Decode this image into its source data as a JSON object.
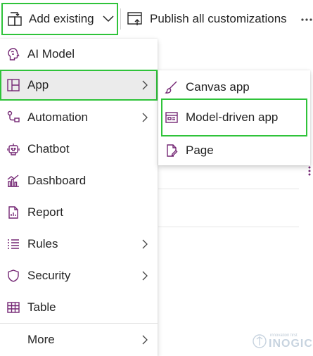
{
  "toolbar": {
    "add_existing_label": "Add existing",
    "publish_label": "Publish all customizations"
  },
  "menu": {
    "items": [
      {
        "label": "AI Model",
        "icon": "ai-model-icon",
        "has_submenu": false
      },
      {
        "label": "App",
        "icon": "app-icon",
        "has_submenu": true
      },
      {
        "label": "Automation",
        "icon": "automation-icon",
        "has_submenu": true
      },
      {
        "label": "Chatbot",
        "icon": "chatbot-icon",
        "has_submenu": false
      },
      {
        "label": "Dashboard",
        "icon": "dashboard-icon",
        "has_submenu": false
      },
      {
        "label": "Report",
        "icon": "report-icon",
        "has_submenu": false
      },
      {
        "label": "Rules",
        "icon": "rules-icon",
        "has_submenu": true
      },
      {
        "label": "Security",
        "icon": "security-icon",
        "has_submenu": true
      },
      {
        "label": "Table",
        "icon": "table-icon",
        "has_submenu": false
      },
      {
        "label": "More",
        "icon": "",
        "has_submenu": true
      }
    ]
  },
  "submenu": {
    "items": [
      {
        "label": "Canvas app",
        "icon": "canvas-app-icon"
      },
      {
        "label": "Model-driven app",
        "icon": "model-driven-app-icon"
      },
      {
        "label": "Page",
        "icon": "page-icon"
      }
    ]
  },
  "watermark": {
    "tagline": "innovation first",
    "brand": "INOGIC"
  },
  "colors": {
    "accent": "#742774",
    "highlight_border": "#2fc33a",
    "selected_bg": "#ebebeb"
  }
}
